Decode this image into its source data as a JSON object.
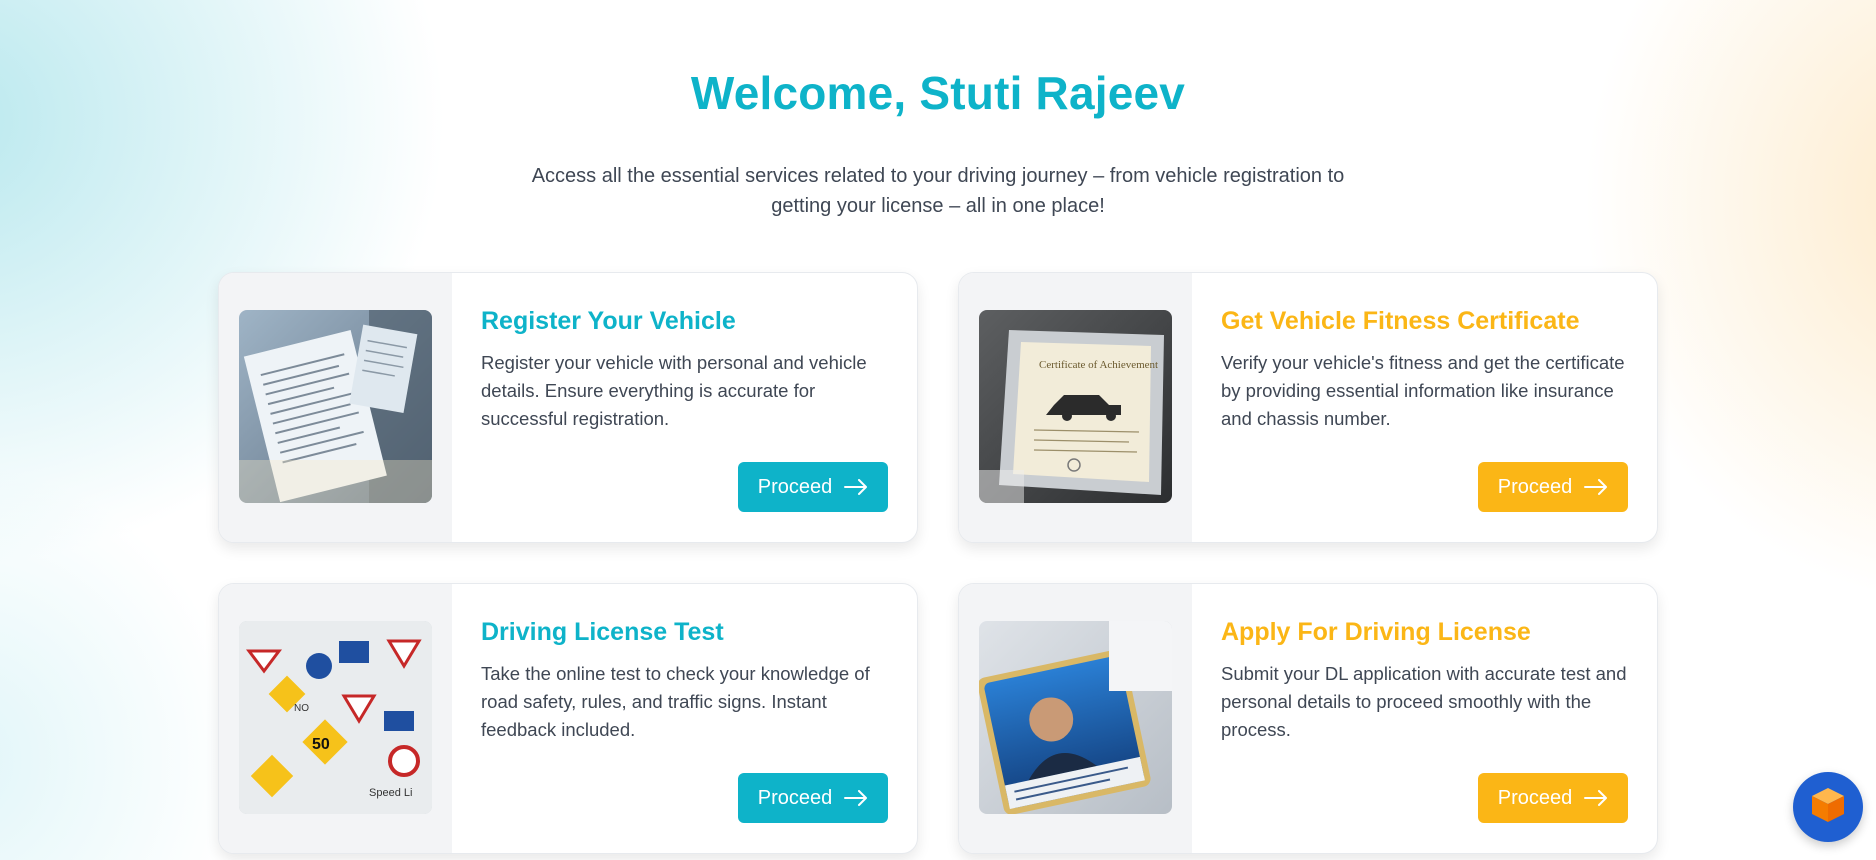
{
  "hero": {
    "title": "Welcome, Stuti Rajeev",
    "subtitle": "Access all the essential services related to your driving journey – from vehicle registration to getting your license – all in one place!"
  },
  "cards": [
    {
      "title": "Register Your Vehicle",
      "description": "Register your vehicle with personal and vehicle details. Ensure everything is accurate for successful registration.",
      "button": "Proceed",
      "accent": "#0eb3c9",
      "image": "vehicle-registration-documents-image"
    },
    {
      "title": "Get Vehicle Fitness Certificate",
      "description": "Verify your vehicle's fitness and get the certificate by providing essential information like insurance and chassis number.",
      "button": "Proceed",
      "accent": "#fbb616",
      "image": "fitness-certificate-image"
    },
    {
      "title": "Driving License Test",
      "description": "Take the online test to check your knowledge of road safety, rules, and traffic signs. Instant feedback included.",
      "button": "Proceed",
      "accent": "#0eb3c9",
      "image": "traffic-signs-test-image"
    },
    {
      "title": "Apply For Driving License",
      "description": "Submit your DL application with accurate test and personal details to proceed smoothly with the process.",
      "button": "Proceed",
      "accent": "#fbb616",
      "image": "driving-license-card-image"
    }
  ],
  "icons": {
    "button_arrow": "arrow-right-icon",
    "floating_button": "cube-icon"
  }
}
